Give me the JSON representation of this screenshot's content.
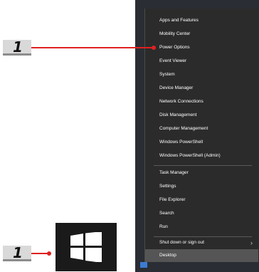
{
  "callouts": [
    {
      "number": "1"
    },
    {
      "number": "1"
    }
  ],
  "start_button": {
    "icon": "windows-logo-icon"
  },
  "menu": {
    "group1": [
      "Apps and Features",
      "Mobility Center",
      "Power Options",
      "Event Viewer",
      "System",
      "Device Manager",
      "Network Connections",
      "Disk Management",
      "Computer Management",
      "Windows PowerShell",
      "Windows PowerShell (Admin)"
    ],
    "group2": [
      "Task Manager",
      "Settings",
      "File Explorer",
      "Search",
      "Run"
    ],
    "group3": [
      "Shut down or sign out",
      "Desktop"
    ],
    "chevron": "›"
  },
  "colors": {
    "callout_line": "#e02020",
    "menu_bg": "#2b2b2b",
    "start_tile": "#1a1a1a"
  }
}
